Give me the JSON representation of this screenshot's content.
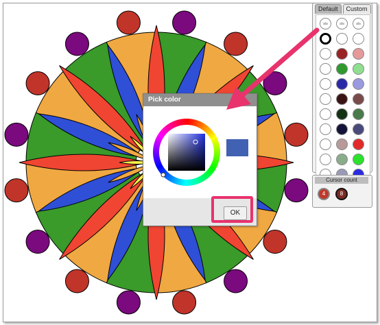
{
  "palette": {
    "tabs": [
      {
        "label": "Default",
        "active": true
      },
      {
        "label": "Custom",
        "active": false
      }
    ],
    "mini_labels": [
      "ala",
      "ala",
      "ala"
    ],
    "rows": [
      [
        "#ffffff",
        "#ffffff",
        "#ffffff"
      ],
      [
        "#ffffff",
        "#9a2323",
        "#e69a9a"
      ],
      [
        "#ffffff",
        "#2e9a2e",
        "#90df90"
      ],
      [
        "#ffffff",
        "#2a2aa8",
        "#9a9ae0"
      ],
      [
        "#ffffff",
        "#3a1414",
        "#7a4a4a"
      ],
      [
        "#ffffff",
        "#143214",
        "#4a7a4a"
      ],
      [
        "#ffffff",
        "#14143a",
        "#4a4a7a"
      ],
      [
        "#ffffff",
        "#b89a9a",
        "#e22a2a"
      ],
      [
        "#ffffff",
        "#8aac8a",
        "#2ae22a"
      ],
      [
        "#ffffff",
        "#9a9ab8",
        "#2a2ae2"
      ]
    ],
    "selected": "row-0-col-0"
  },
  "cursor_panel": {
    "title": "Cursor count",
    "options": [
      {
        "label": "4",
        "active": false
      },
      {
        "label": "8",
        "active": true
      }
    ]
  },
  "dialog": {
    "title": "Pick color",
    "ok_label": "OK",
    "selected_color": "#4161b3"
  },
  "colors": {
    "mandala_red": "#f04532",
    "mandala_blue": "#2f4fd6",
    "mandala_green": "#3a9a2a",
    "mandala_orange": "#f0a842",
    "mandala_purple": "#7a0a7e",
    "mandala_brick": "#c0342a",
    "mandala_yellow": "#f8f04a",
    "annotation_pink": "#e8336d"
  }
}
